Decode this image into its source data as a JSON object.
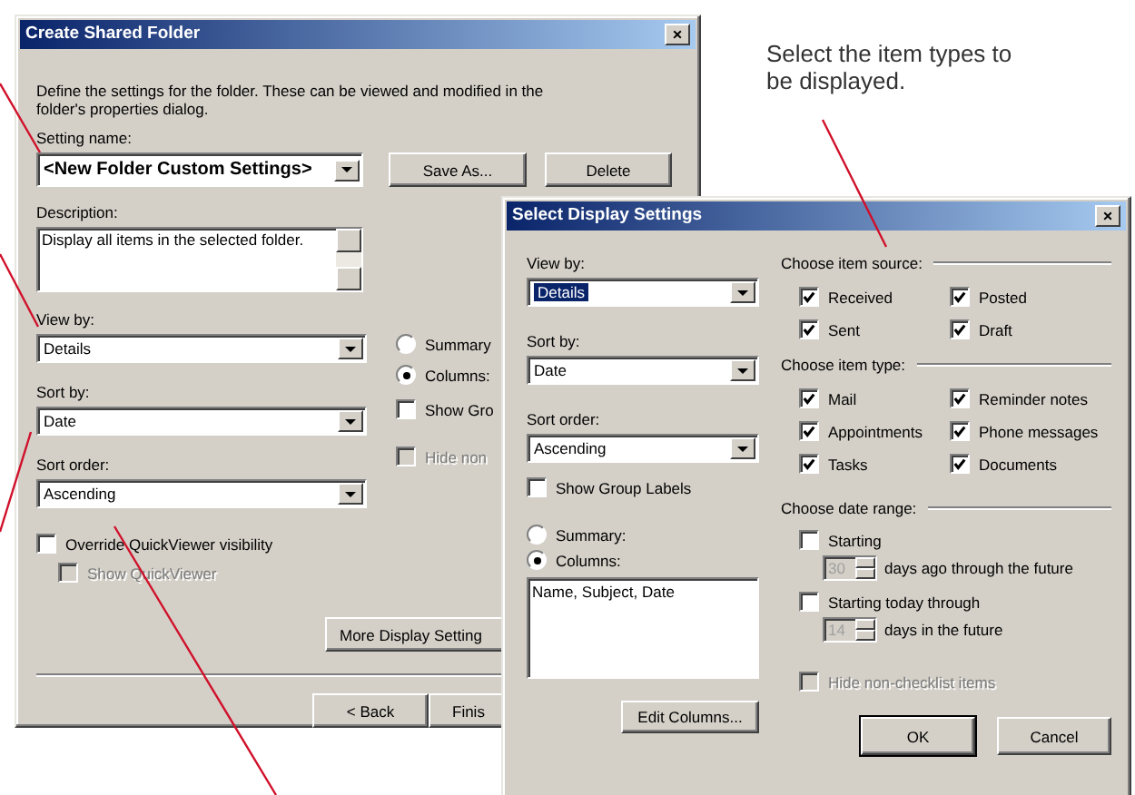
{
  "callout": {
    "text": "Select the item types to be displayed."
  },
  "create_dialog": {
    "title": "Create Shared Folder",
    "close": "×",
    "intro": "Define the settings for the folder.  These can be viewed and modified in the folder's properties dialog.",
    "setting_name": {
      "label": "Setting name:",
      "value": "<New Folder Custom Settings>"
    },
    "buttons": [
      "Save As...",
      "Delete"
    ],
    "description": {
      "label": "Description:",
      "value": "Display all items in the selected folder."
    },
    "dropdowns": [
      {
        "label": "View by:",
        "value": "Details"
      },
      {
        "label": "Sort by:",
        "value": "Date"
      },
      {
        "label": "Sort order:",
        "value": "Ascending"
      }
    ],
    "view_options": [
      {
        "label": "Summary",
        "selected": false
      },
      {
        "label": "Columns:",
        "selected": true
      }
    ],
    "checkboxes": [
      {
        "label": "Show Gro",
        "checked": false,
        "disabled": false
      },
      {
        "label": "Hide non",
        "checked": false,
        "disabled": true
      }
    ],
    "quickviewer": [
      {
        "label": "Override QuickViewer visibility",
        "checked": false,
        "disabled": false
      },
      {
        "label": "Show QuickViewer",
        "checked": false,
        "disabled": true
      }
    ],
    "more_button": "More Display Setting",
    "nav_buttons": [
      "< Back",
      "Finis"
    ]
  },
  "display_dialog": {
    "title": "Select Display Settings",
    "close": "×",
    "dropdowns": [
      {
        "label": "View by:",
        "value": "Details",
        "selected": true
      },
      {
        "label": "Sort by:",
        "value": "Date",
        "selected": false
      },
      {
        "label": "Sort order:",
        "value": "Ascending",
        "selected": false
      }
    ],
    "show_group_labels": {
      "label": "Show Group Labels",
      "checked": false
    },
    "view_options": [
      {
        "label": "Summary:",
        "selected": false
      },
      {
        "label": "Columns:",
        "selected": true
      }
    ],
    "columns_list": "Name, Subject, Date",
    "edit_button": "Edit Columns...",
    "item_source": {
      "title": "Choose item source:",
      "items": [
        {
          "label": "Received",
          "checked": true
        },
        {
          "label": "Posted",
          "checked": true
        },
        {
          "label": "Sent",
          "checked": true
        },
        {
          "label": "Draft",
          "checked": true
        }
      ]
    },
    "item_type": {
      "title": "Choose item type:",
      "items": [
        {
          "label": "Mail",
          "checked": true
        },
        {
          "label": "Reminder notes",
          "checked": true
        },
        {
          "label": "Appointments",
          "checked": true
        },
        {
          "label": "Phone messages",
          "checked": true
        },
        {
          "label": "Tasks",
          "checked": true
        },
        {
          "label": "Documents",
          "checked": true
        }
      ]
    },
    "date_range": {
      "title": "Choose date range:",
      "options": [
        {
          "label": "Starting",
          "checked": false,
          "spin_value": "30",
          "suffix": "days ago through the future"
        },
        {
          "label": "Starting today through",
          "checked": false,
          "spin_value": "14",
          "suffix": "days in the future"
        }
      ]
    },
    "hide_checkbox": {
      "label": "Hide non-checklist items",
      "checked": false,
      "disabled": true
    },
    "buttons": [
      "OK",
      "Cancel"
    ]
  }
}
